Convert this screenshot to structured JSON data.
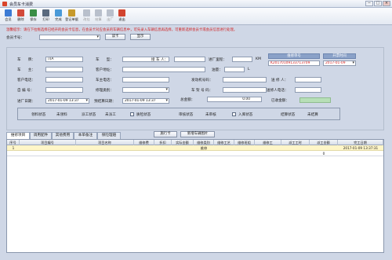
{
  "window": {
    "title": "会员车卡消费",
    "minimize": "−",
    "maximize": "□",
    "close": "×"
  },
  "toolbar": [
    {
      "label": "会员",
      "color": "#3c7bd4",
      "enabled": true
    },
    {
      "label": "删除",
      "color": "#d24a3a",
      "enabled": true
    },
    {
      "label": "保存",
      "color": "#3a8e46",
      "enabled": true
    },
    {
      "label": "打印",
      "color": "#5a6a7e",
      "enabled": true
    },
    {
      "label": "完成",
      "color": "#4a9ad8",
      "enabled": true
    },
    {
      "label": "登记单据",
      "color": "#c79a2c",
      "enabled": true
    },
    {
      "label": "改挂",
      "color": "#b9c0cc",
      "enabled": false
    },
    {
      "label": "结算",
      "color": "#b9c0cc",
      "enabled": false
    },
    {
      "label": "出厂",
      "color": "#b9c0cc",
      "enabled": false
    },
    {
      "label": "退出",
      "color": "#d2442f",
      "enabled": true
    }
  ],
  "warning": "温馨提示：请在下拉框选择已经开的会员卡信息，在会员卡对应会员的车辆信息中，可先录入车辆信息再选择，可重新选择会员卡或会员信息进行处理。",
  "member": {
    "label": "会员卡号：",
    "value": "",
    "read_button": "读卡",
    "show_button": "显示"
  },
  "fields": {
    "plate_label": "车　　牌：",
    "plate_value": "川A",
    "model_label": "车　　型：",
    "model_value": "",
    "contact_label": "接 车 人：",
    "contact_value": "",
    "mileage_label": "进厂里程：",
    "mileage_value": "",
    "mileage_unit": "KM",
    "owner_label": "车　　主：",
    "owner_value": "",
    "address_label": "客户地址：",
    "address_value": "",
    "fuel_label": "油量：",
    "fuel_value": "",
    "fuel_unit": "L",
    "phone_label": "客户电话：",
    "phone_value": "",
    "owner_phone_label": "车主电话：",
    "owner_phone_value": "",
    "engine_label": "发动机号码：",
    "engine_value": "",
    "sender_label": "送 修 人：",
    "sender_value": "",
    "custno_label": "自 编 号：",
    "custno_value": "",
    "repair_type_label": "修理类别：",
    "repair_type_value": "",
    "vin_label": "车 架 号 码：",
    "vin_value": "",
    "sender_phone_label": "送修人电话：",
    "sender_phone_value": "",
    "entry_date_label": "进厂日期：",
    "entry_date_value": "2017-01-09 13:37",
    "finish_date_label": "预结算日期：",
    "finish_date_value": "2017-01-09 13:37",
    "total_label": "总金额：",
    "total_value": "0.00",
    "paid_label": "已收金额："
  },
  "order": {
    "header": "维修单号",
    "value": "K20170109133713709",
    "time_header": "开票时间",
    "time_value": "2017-01-09"
  },
  "status": {
    "pick_label": "领料状态",
    "pick_value": "未领料",
    "work_label": "派工状态",
    "work_value": "未派工",
    "qc_label": "质检状态",
    "audit_label": "审核状态",
    "audit_value": "未审核",
    "store_label": "入库状态",
    "settle_label": "结算状态",
    "settle_value": "未结算"
  },
  "tabs": [
    "维修项目",
    "调用配件",
    "其他费用",
    "本单备注",
    "保险理赔"
  ],
  "buttons": {
    "work_order": "施行卡",
    "add_image": "新增车辆图片"
  },
  "grid": {
    "headers": [
      "序号",
      "项目编号",
      "项目名称",
      "维修费",
      "折扣",
      "实际金额",
      "维修类别",
      "维修工艺",
      "维修班组",
      "维修工",
      "派工工时",
      "派工金额",
      "完工日期"
    ],
    "rows": [
      [
        "1",
        "",
        "",
        "",
        "",
        "",
        "维修",
        "",
        "",
        "",
        "",
        "",
        "2017-01-09 13:37:31"
      ]
    ],
    "footer": [
      "",
      "",
      "",
      "",
      "",
      "",
      "",
      "",
      "",
      "",
      "",
      "0",
      ""
    ]
  }
}
